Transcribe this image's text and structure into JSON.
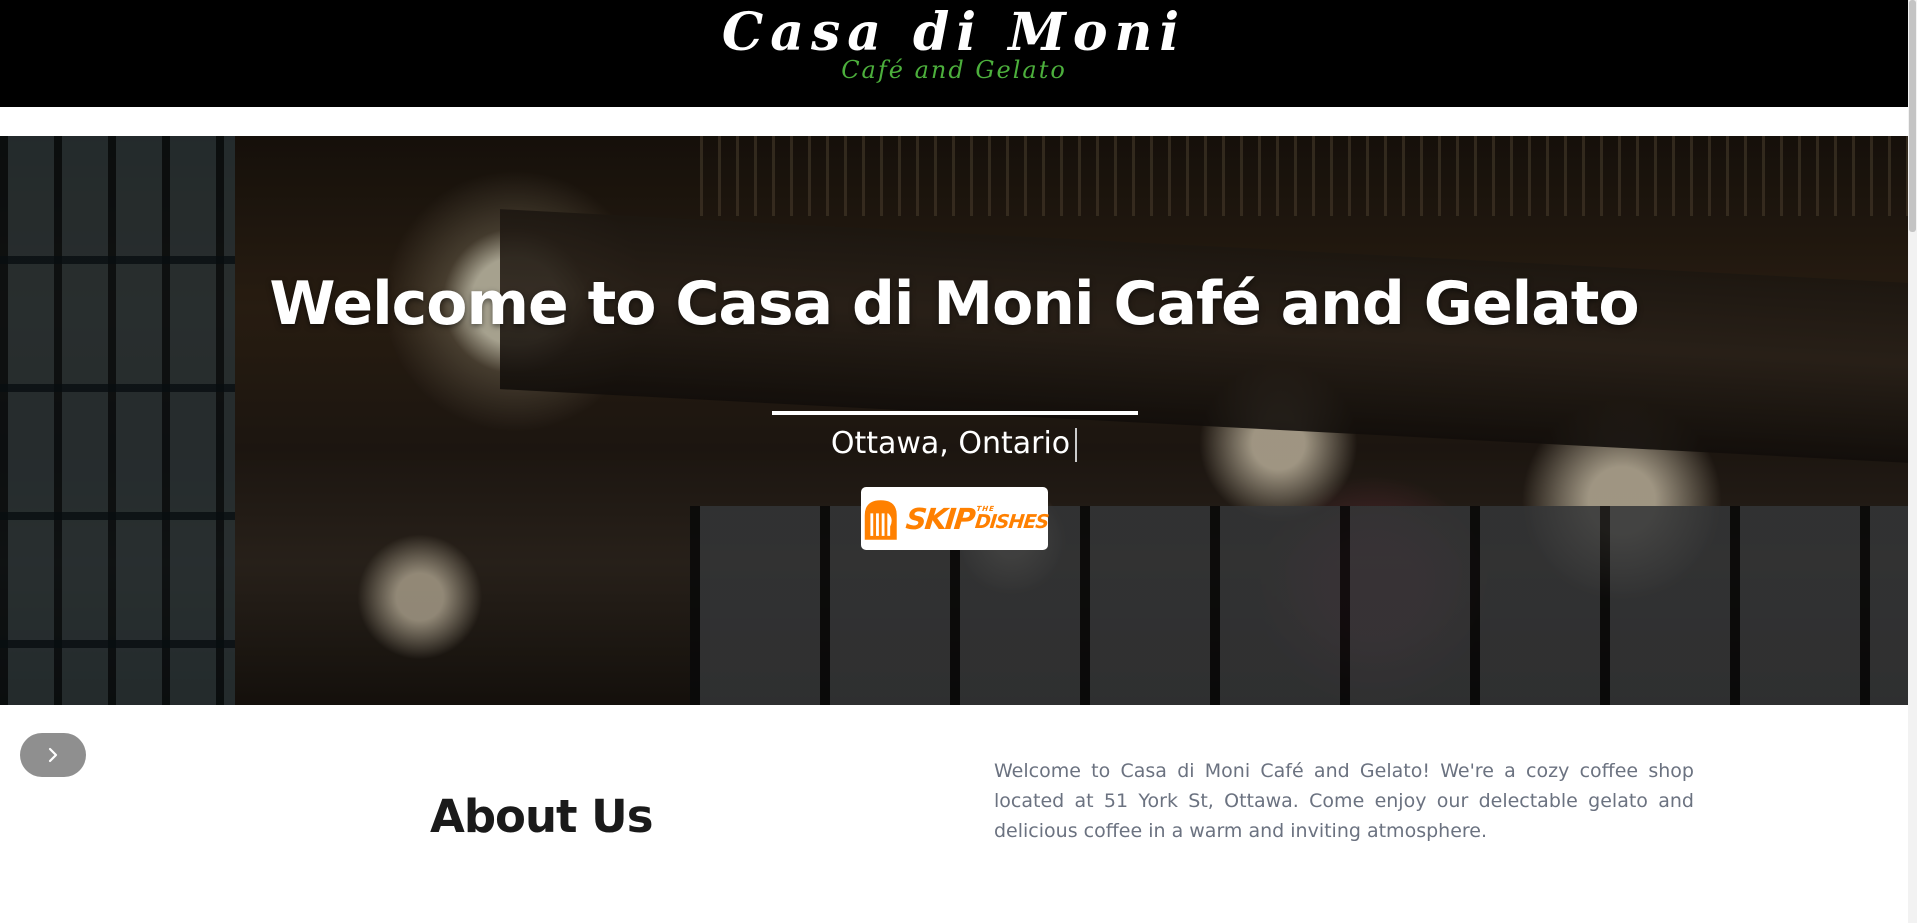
{
  "header": {
    "logo_title": "Casa di Moni",
    "logo_subtitle": "Café and Gelato"
  },
  "hero": {
    "title": "Welcome to Casa di Moni Café and Gelato",
    "location": "Ottawa, Ontario",
    "order_button": {
      "brand_word": "SKIP",
      "brand_small": "THE",
      "brand_word2": "DISHES",
      "icon": "skip-the-dishes-logo-icon",
      "color": "#ff8000"
    }
  },
  "carousel": {
    "next_icon": "chevron-right-icon"
  },
  "about": {
    "heading": "About Us",
    "text": "Welcome to Casa di Moni Café and Gelato! We're a cozy coffee shop located at 51 York St, Ottawa. Come enjoy our delectable gelato and delicious coffee in a warm and inviting atmosphere."
  },
  "colors": {
    "header_bg": "#000000",
    "subtitle_green": "#4caf3c",
    "body_text": "#6b7280",
    "heading_text": "#1a1a1a"
  }
}
